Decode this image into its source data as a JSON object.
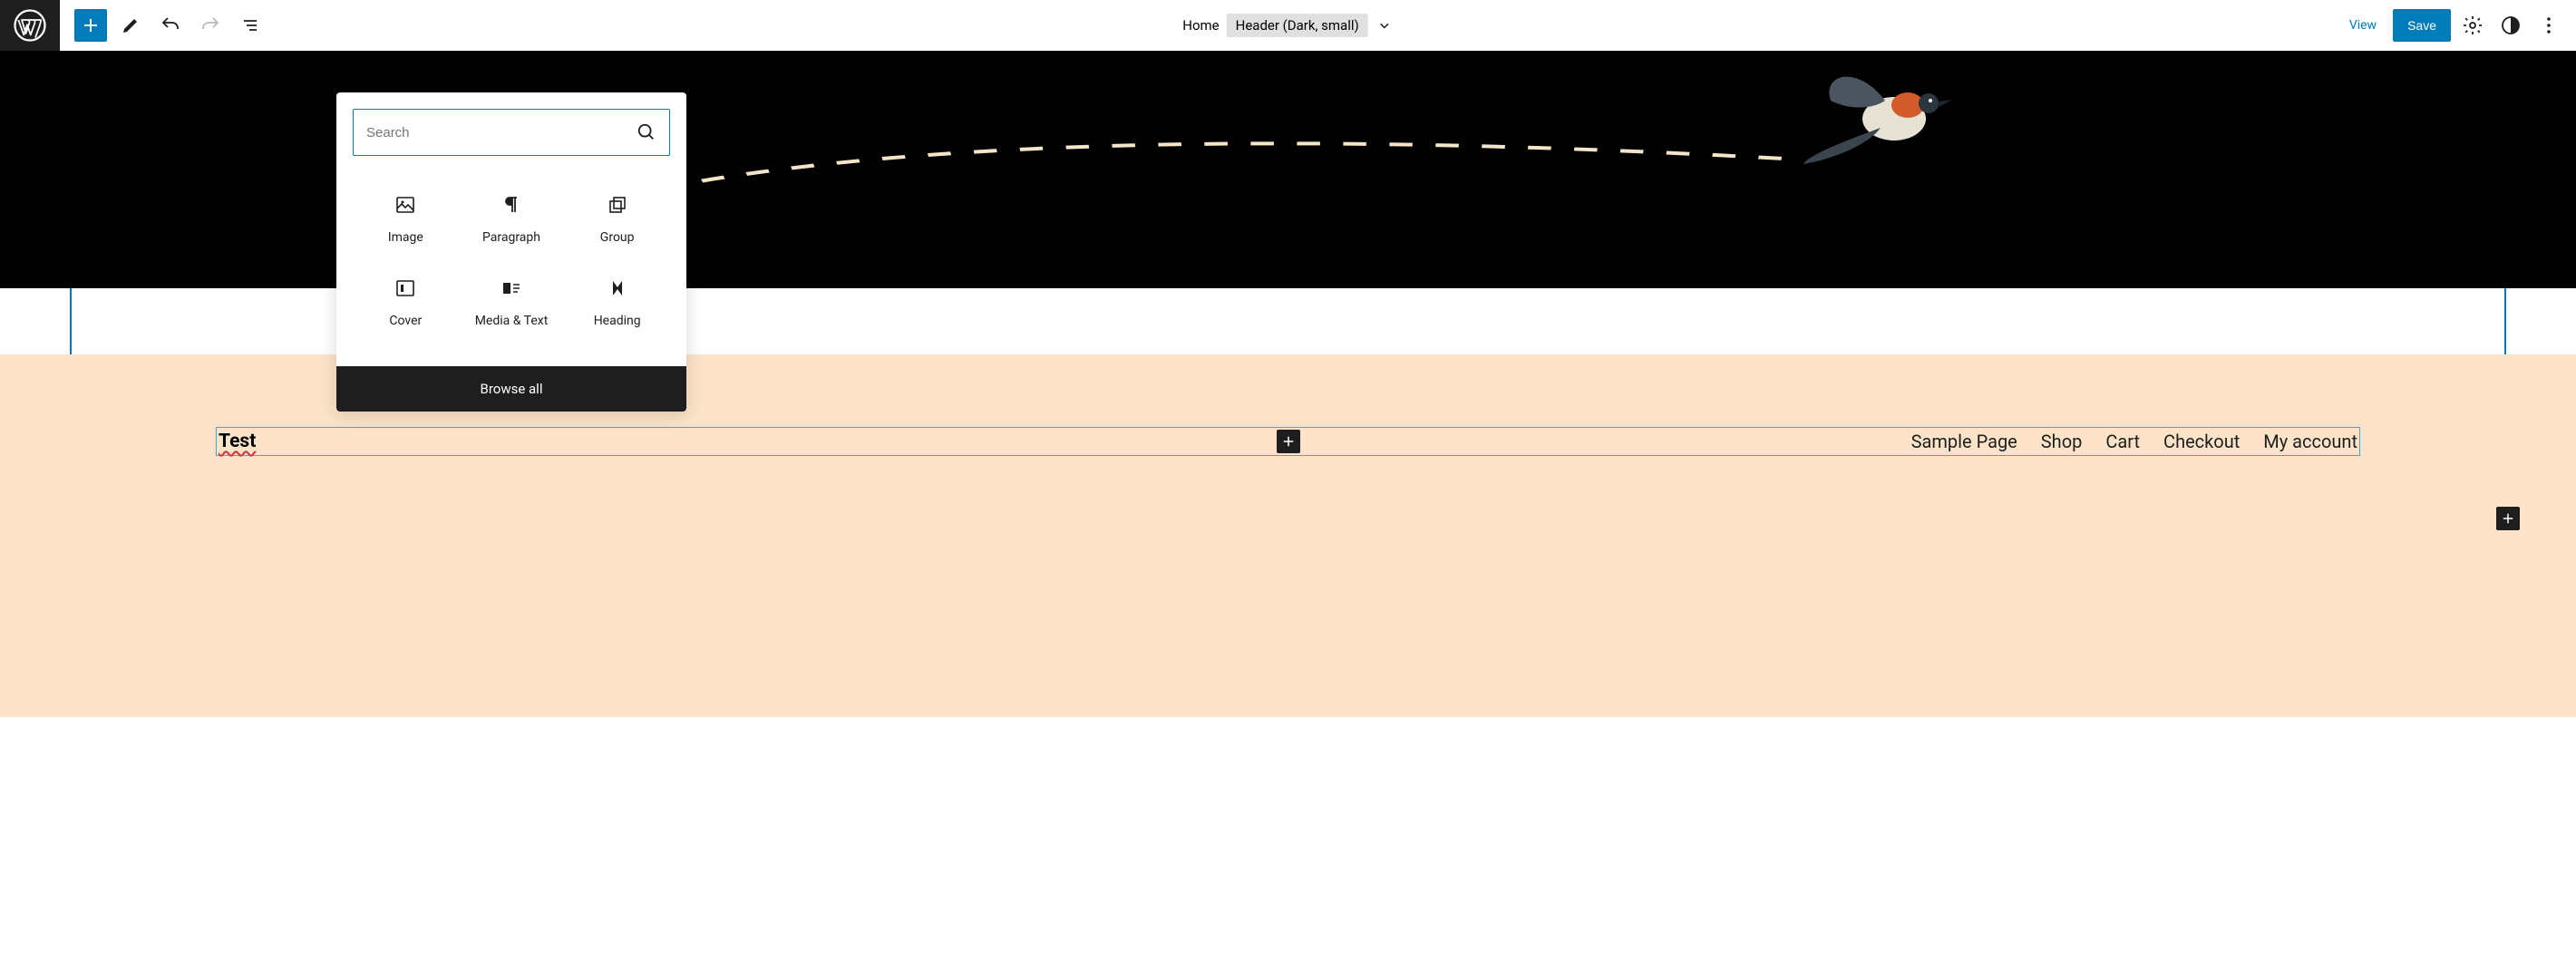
{
  "topbar": {
    "doc_home": "Home",
    "doc_template": "Header (Dark, small)",
    "view": "View",
    "save": "Save"
  },
  "inserter": {
    "search_placeholder": "Search",
    "blocks": [
      {
        "label": "Image"
      },
      {
        "label": "Paragraph"
      },
      {
        "label": "Group"
      },
      {
        "label": "Cover"
      },
      {
        "label": "Media & Text"
      },
      {
        "label": "Heading"
      }
    ],
    "browse_all": "Browse all"
  },
  "site": {
    "title": "Test",
    "nav": [
      "Sample Page",
      "Shop",
      "Cart",
      "Checkout",
      "My account"
    ]
  }
}
